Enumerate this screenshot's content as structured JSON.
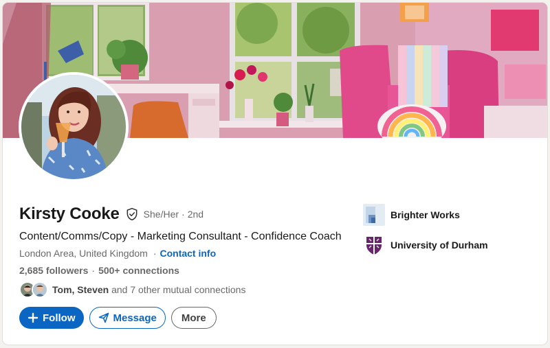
{
  "profile": {
    "name": "Kirsty Cooke",
    "pronouns": "She/Her",
    "separator": "·",
    "degree": "2nd",
    "headline": "Content/Comms/Copy - Marketing Consultant - Confidence Coach",
    "location": "London Area, United Kingdom",
    "contact_info": "Contact info",
    "followers": "2,685 followers",
    "connections": "500+ connections",
    "mutual_names": "Tom, Steven",
    "mutual_rest": "and 7 other mutual connections"
  },
  "actions": {
    "follow_label": "Follow",
    "message_label": "Message",
    "more_label": "More"
  },
  "orgs": [
    {
      "name": "Brighter Works",
      "logo": "brighter-works-logo"
    },
    {
      "name": "University of Durham",
      "logo": "durham-crest-logo"
    }
  ],
  "icons": {
    "verified": "verified-shield-icon",
    "follow": "plus-icon",
    "message": "send-icon"
  },
  "colors": {
    "brand_blue": "#0a66c2",
    "muted_text": "#666666",
    "durham_purple": "#68246d"
  }
}
